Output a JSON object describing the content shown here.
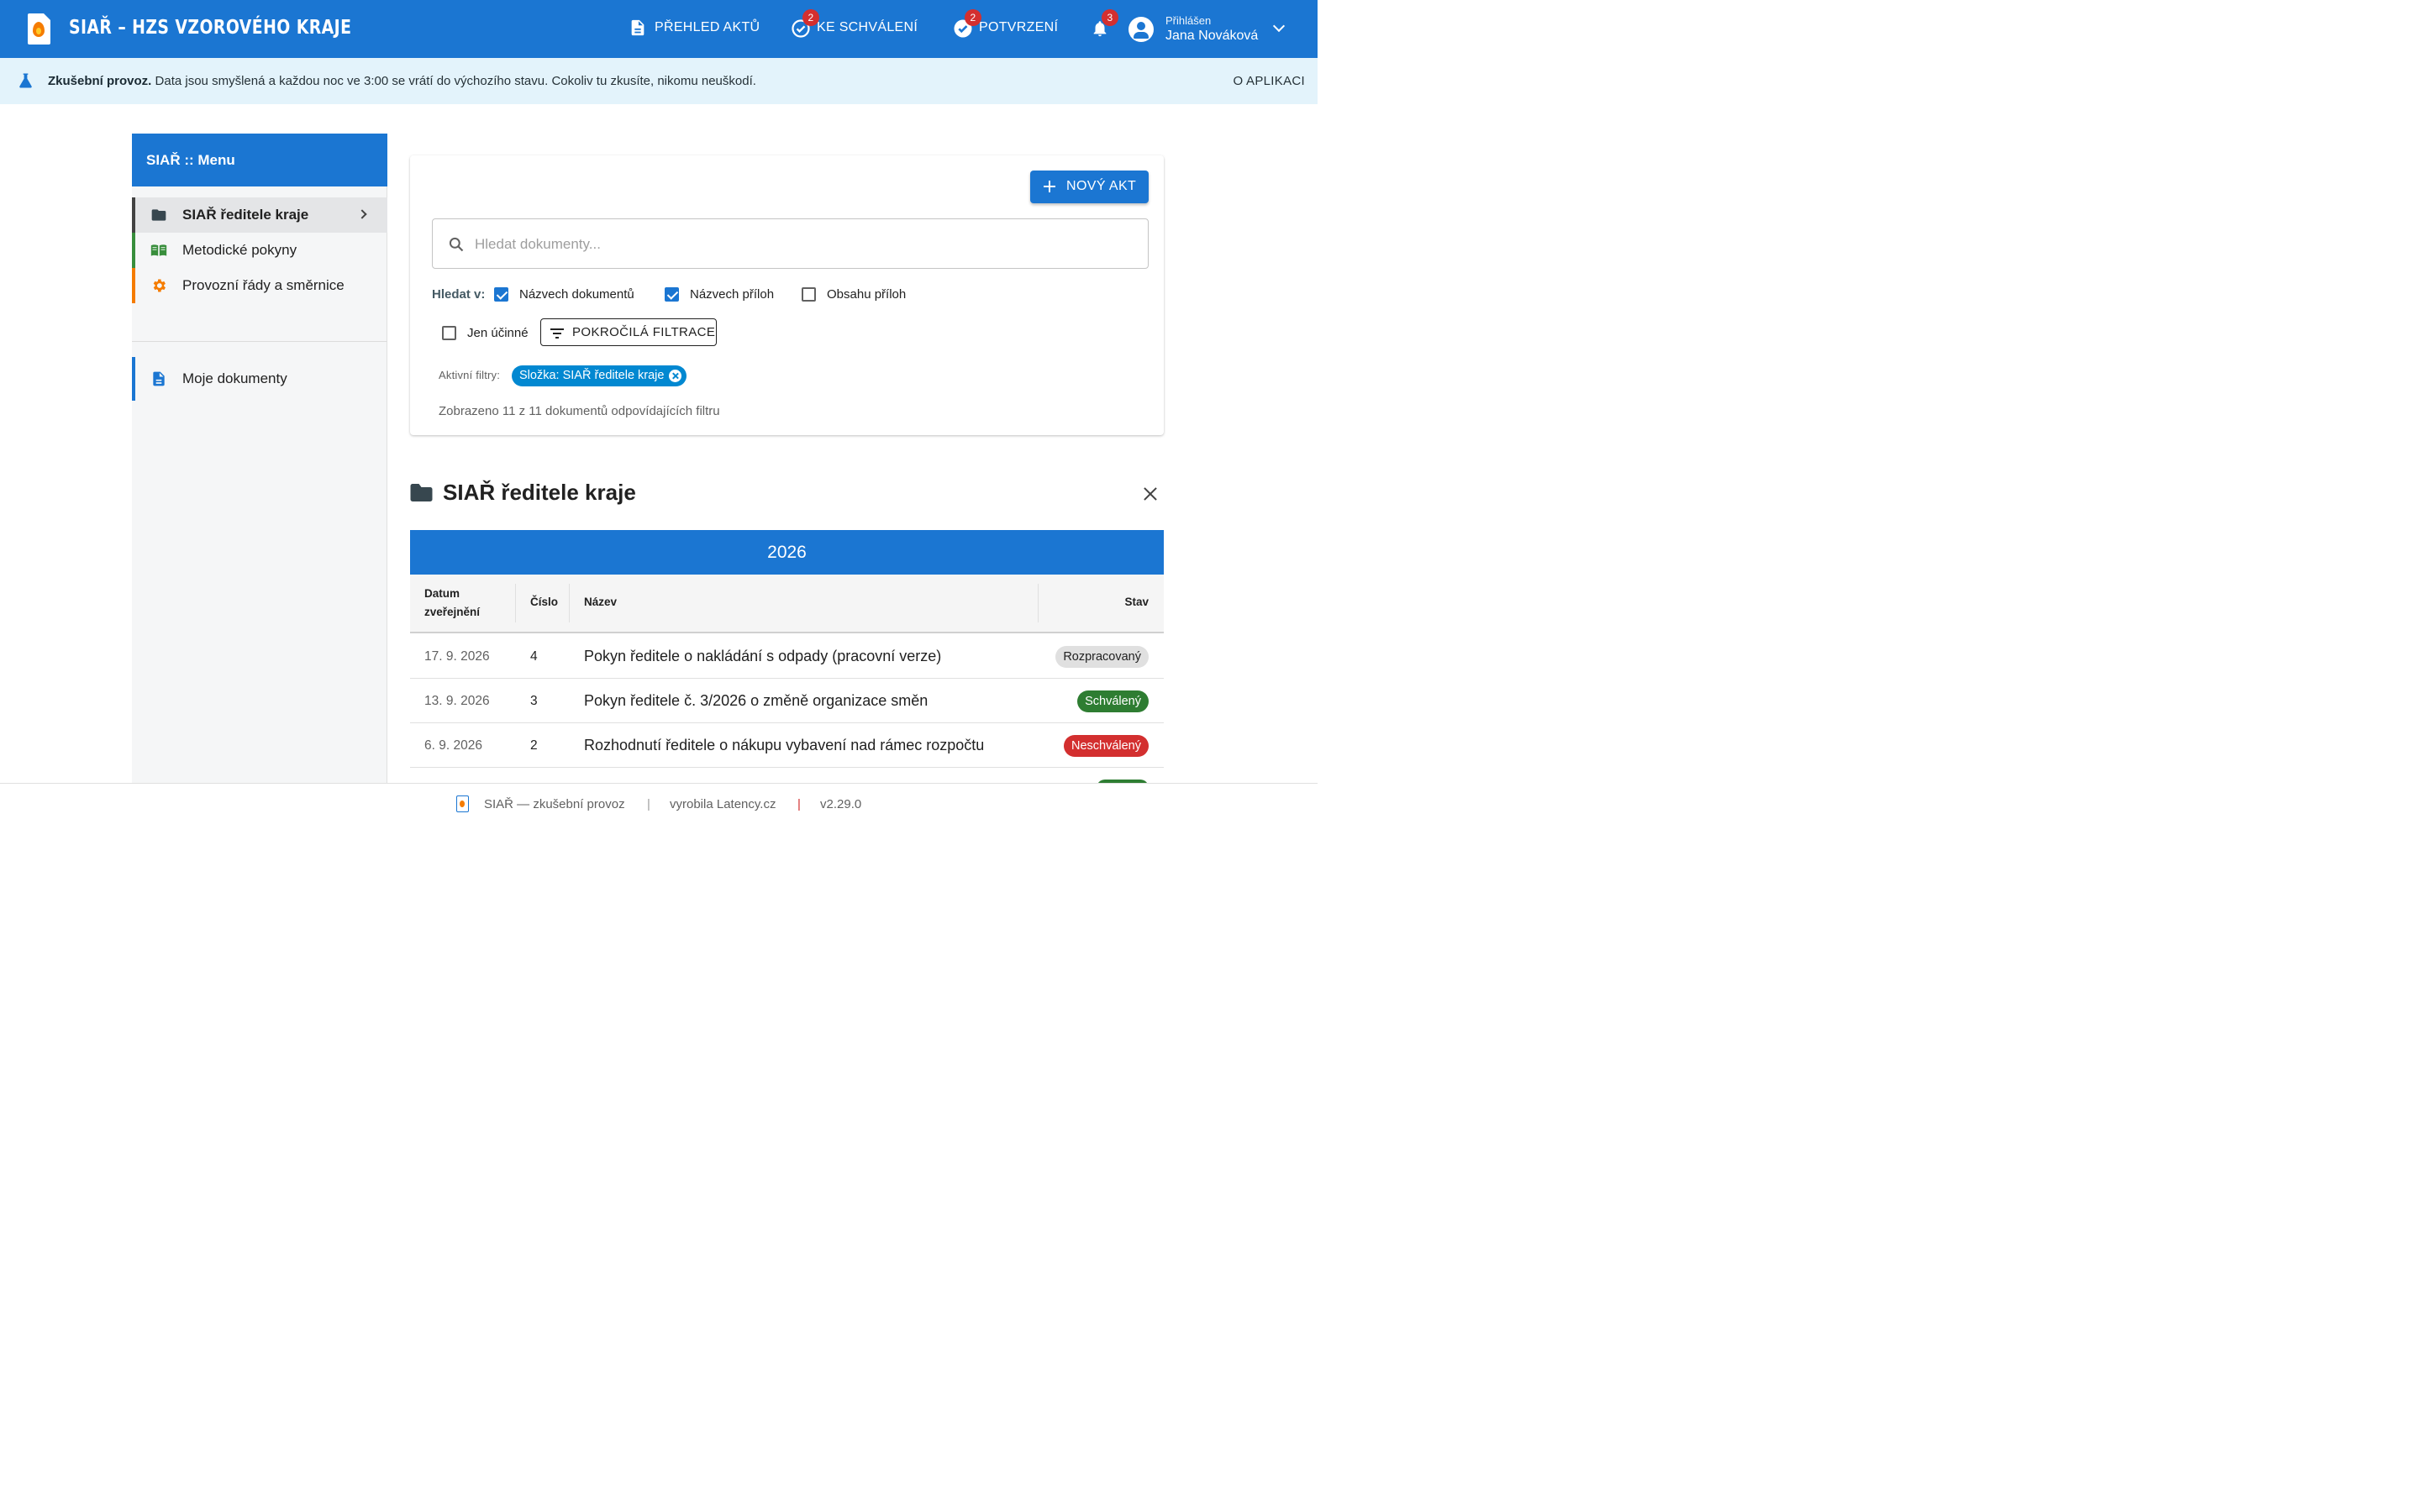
{
  "header": {
    "app_title": "SIAŘ – HZS VZOROVÉHO KRAJE",
    "nav": [
      {
        "label": "PŘEHLED AKTŮ",
        "icon": "document-icon",
        "badge": ""
      },
      {
        "label": "KE SCHVÁLENÍ",
        "icon": "check-circle-outline-icon",
        "badge": "2"
      },
      {
        "label": "POTVRZENÍ",
        "icon": "check-circle-icon",
        "badge": "2"
      }
    ],
    "notifications_badge": "3",
    "user": {
      "caption": "Přihlášen",
      "name": "Jana Nováková"
    }
  },
  "banner": {
    "bold": "Zkušební provoz.",
    "text": "Data jsou smyšlená a každou noc ve 3:00 se vrátí do výchozího stavu. Cokoliv tu zkusíte, nikomu neuškodí.",
    "about": "O APLIKACI"
  },
  "sidebar": {
    "title": "SIAŘ :: Menu",
    "items": [
      {
        "label": "SIAŘ ředitele kraje",
        "icon": "folder-icon",
        "accent": "#424242"
      },
      {
        "label": "Metodické pokyny",
        "icon": "book-icon",
        "accent": "#388e3c"
      },
      {
        "label": "Provozní řády a směrnice",
        "icon": "gear-icon",
        "accent": "#f57c00"
      },
      {
        "label": "Moje dokumenty",
        "icon": "document-icon",
        "accent": "#1b76d2"
      }
    ]
  },
  "search": {
    "new_button": "NOVÝ AKT",
    "placeholder": "Hledat dokumenty...",
    "value": "",
    "search_in_label": "Hledat v:",
    "options": [
      {
        "label": "Názvech dokumentů",
        "checked": true
      },
      {
        "label": "Názvech příloh",
        "checked": true
      },
      {
        "label": "Obsahu příloh",
        "checked": false
      },
      {
        "label": "Jen účinné",
        "checked": false
      }
    ],
    "advanced_button": "POKROČILÁ FILTRACE",
    "active_filters_label": "Aktivní filtry:",
    "active_filter_chip": "Složka: SIAŘ ředitele kraje",
    "result_count": "Zobrazeno 11 z 11 dokumentů odpovídajících filtru"
  },
  "folder": {
    "title": "SIAŘ ředitele kraje",
    "year": "2026",
    "columns": {
      "date_line1": "Datum",
      "date_line2": "zveřejnění",
      "number": "Číslo",
      "name": "Název",
      "status": "Stav"
    },
    "rows": [
      {
        "date": "17. 9. 2026",
        "number": "4",
        "name": "Pokyn ředitele o nakládání s odpady (pracovní verze)",
        "status": "Rozpracovaný",
        "status_color": "#e0e0e0",
        "status_text_color": "#212121"
      },
      {
        "date": "13. 9. 2026",
        "number": "3",
        "name": "Pokyn ředitele č. 3/2026 o změně organizace směn",
        "status": "Schválený",
        "status_color": "#2e7d32",
        "status_text_color": "#ffffff"
      },
      {
        "date": "6. 9. 2026",
        "number": "2",
        "name": "Rozhodnutí ředitele o nákupu vybavení nad rámec rozpočtu",
        "status": "Neschválený",
        "status_color": "#d32f2f",
        "status_text_color": "#ffffff"
      }
    ]
  },
  "footer": {
    "app": "SIAŘ — zkušební provoz",
    "sep": "|",
    "maker": "vyrobila Latency.cz",
    "version": "v2.29.0"
  },
  "colors": {
    "primary": "#1b76d2",
    "badge": "#d32f2f",
    "banner_bg": "#e3f3fb",
    "chip": "#0288d1"
  }
}
